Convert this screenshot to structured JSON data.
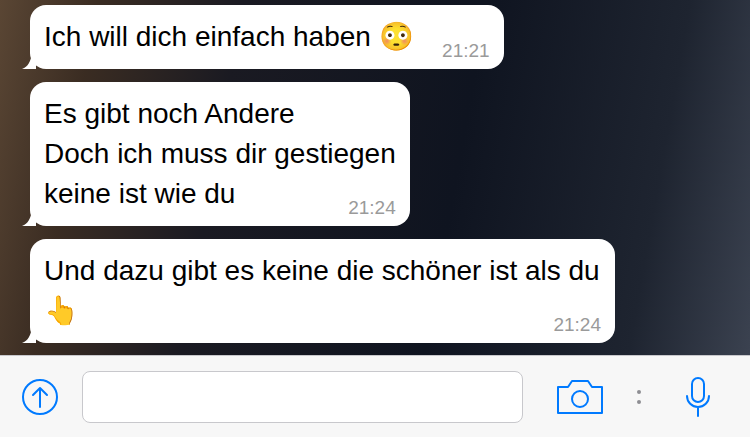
{
  "messages": [
    {
      "text": "Ich will dich einfach haben 😳",
      "time": "21:21"
    },
    {
      "text": "Es gibt noch Andere\nDoch ich muss dir gestiegen\nkeine ist wie du",
      "time": "21:24"
    },
    {
      "text": "Und dazu gibt es keine die schöner ist als du 👆",
      "time": "21:24"
    }
  ]
}
